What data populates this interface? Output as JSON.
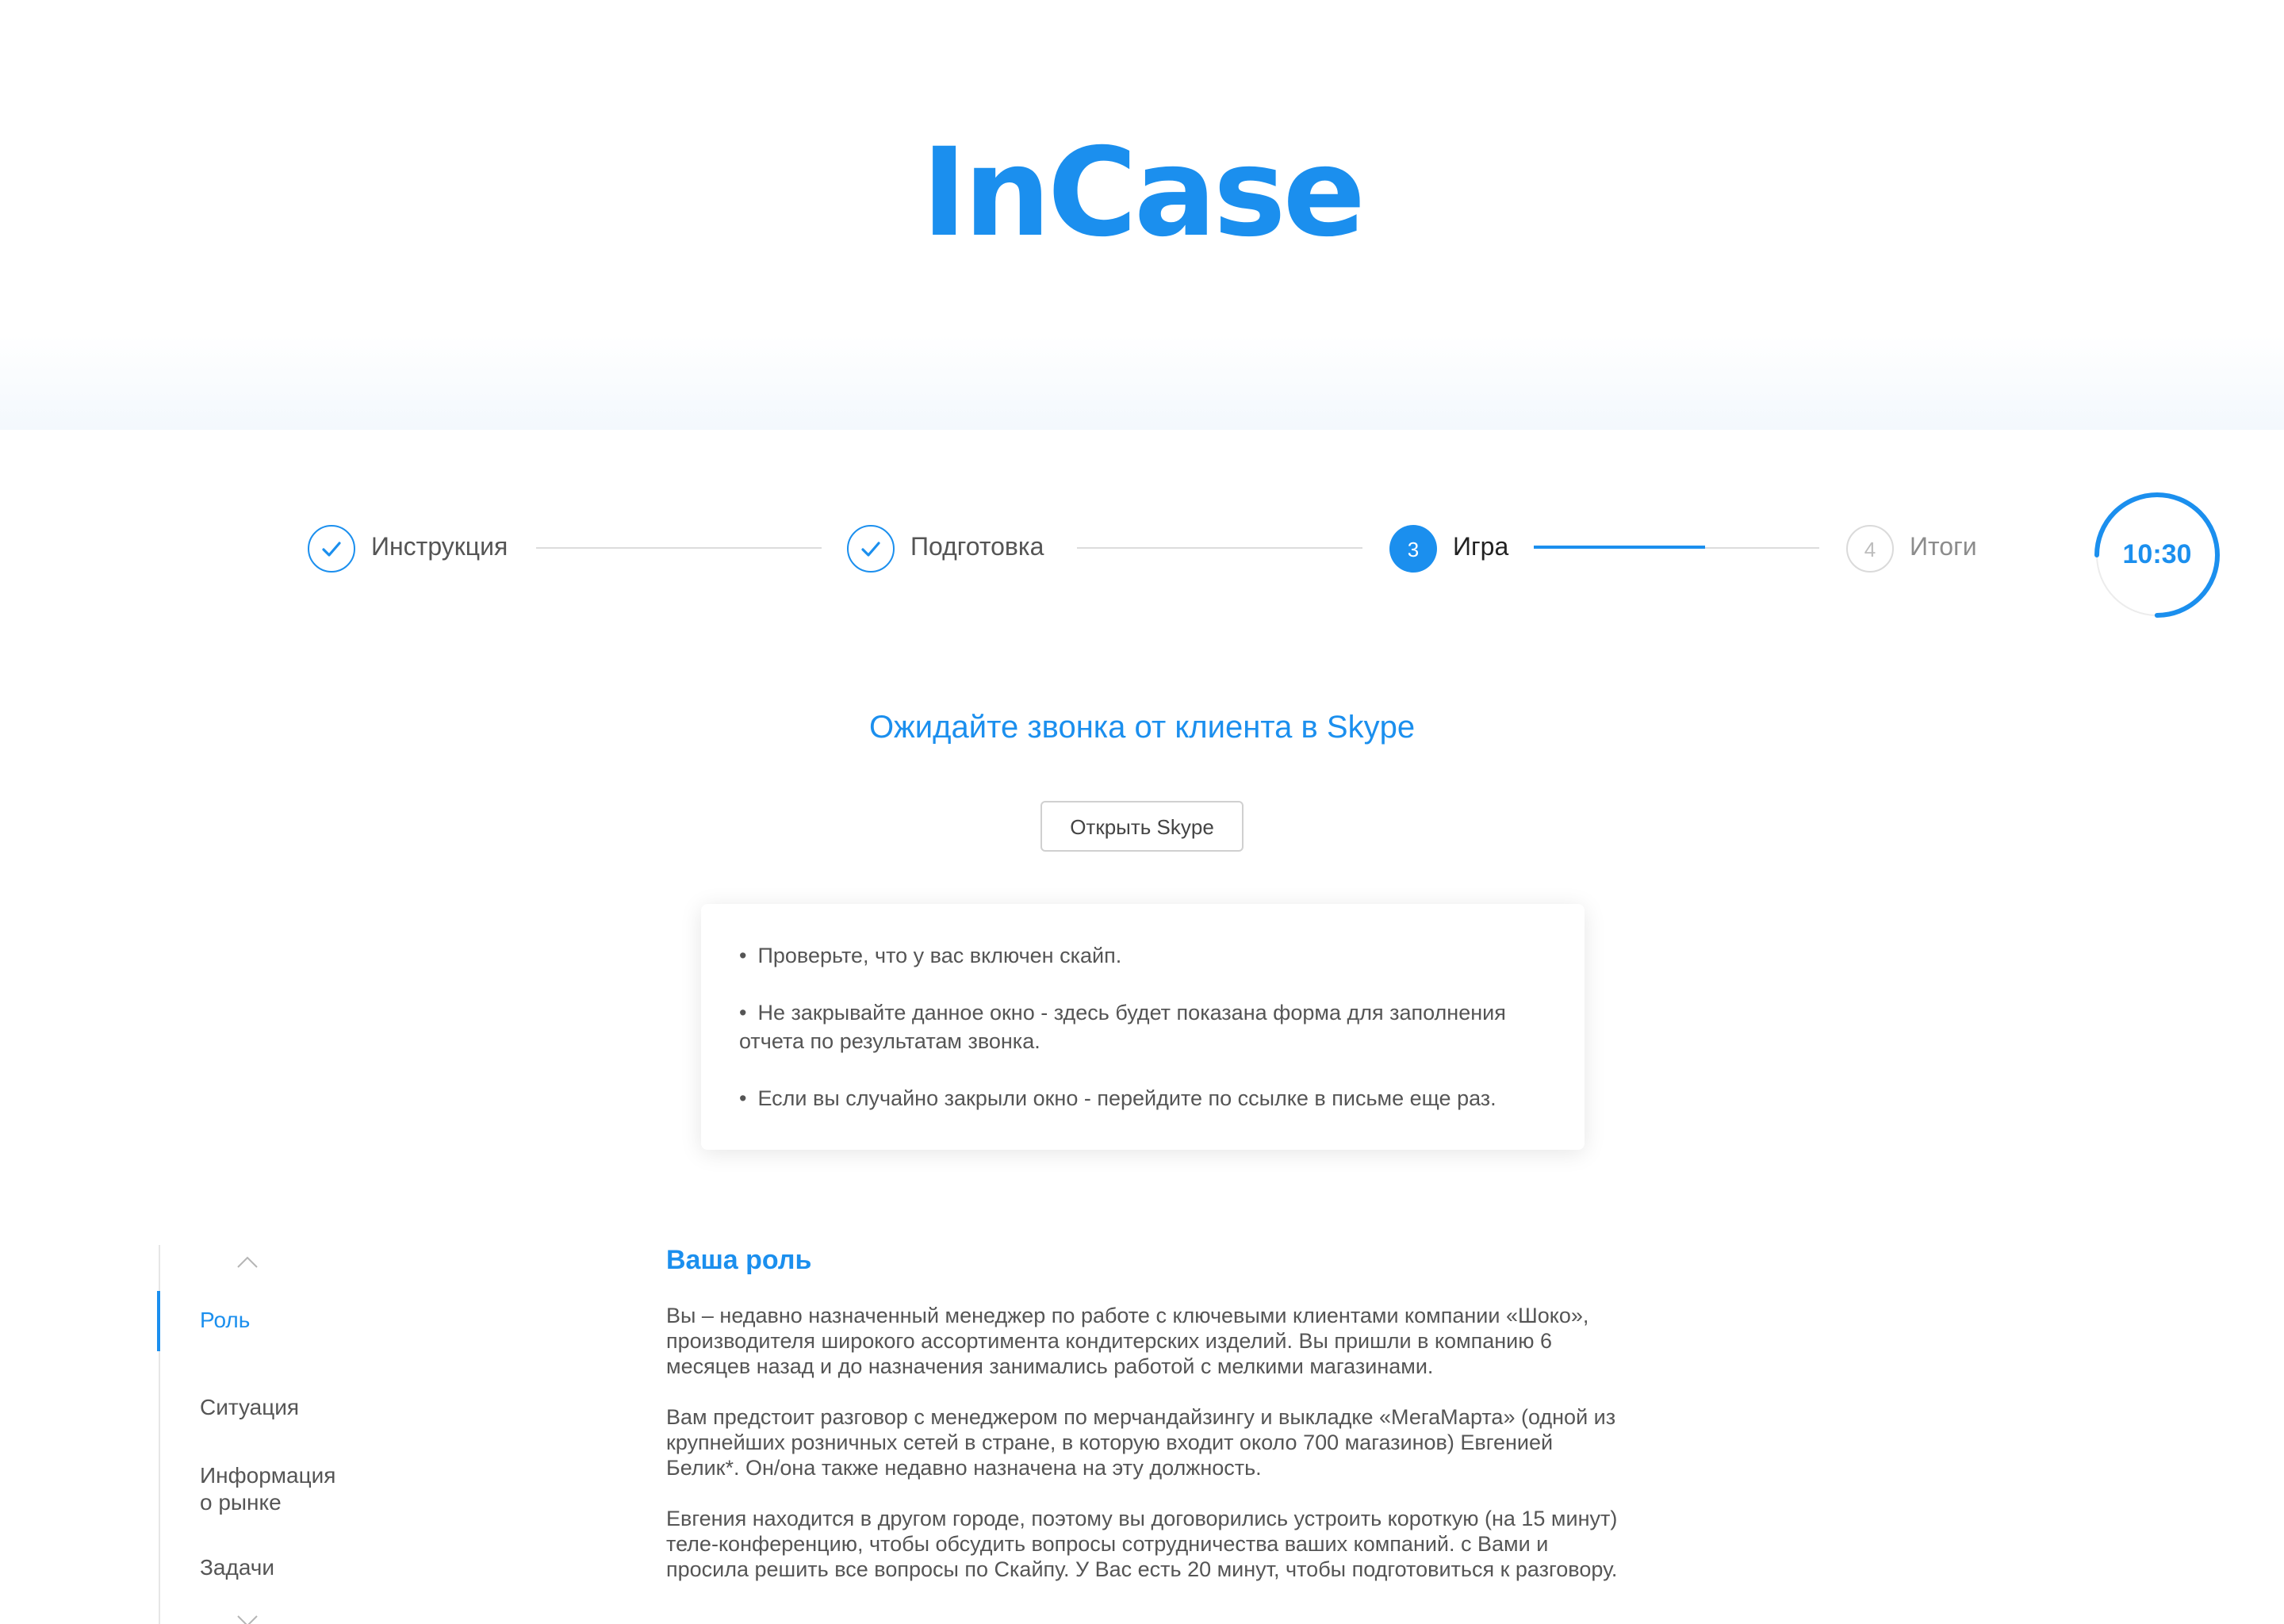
{
  "brand": {
    "logo_text": "InCase",
    "accent_color": "#1b8fee"
  },
  "stepper": {
    "steps": [
      {
        "number": "",
        "label": "Инструкция",
        "state": "done",
        "icon": "check-icon"
      },
      {
        "number": "",
        "label": "Подготовка",
        "state": "done",
        "icon": "check-icon"
      },
      {
        "number": "3",
        "label": "Игра",
        "state": "active"
      },
      {
        "number": "4",
        "label": "Итоги",
        "state": "todo"
      }
    ],
    "current_step_progress": 0.6
  },
  "timer": {
    "value": "10:30",
    "remaining_fraction": 0.75
  },
  "call": {
    "title": "Ожидайте звонка от клиента в Skype",
    "open_button_label": "Открыть Skype",
    "tips": [
      "Проверьте, что у вас включен скайп.",
      "Не закрывайте данное окно - здесь будет показана форма для заполнения отчета по результатам звонка.",
      "Если вы случайно закрыли окно - перейдите по ссылке в письме еще раз."
    ]
  },
  "side_nav": {
    "up_icon": "chevron-up-icon",
    "down_icon": "chevron-down-icon",
    "items": [
      {
        "label": "Роль",
        "active": true
      },
      {
        "label": "Ситуация",
        "active": false
      },
      {
        "label": "Информация\nо рынке",
        "active": false
      },
      {
        "label": "Задачи",
        "active": false
      }
    ]
  },
  "role": {
    "title": "Ваша роль",
    "paragraphs": [
      "Вы – недавно назначенный менеджер по работе с ключевыми клиентами компании «Шоко», производителя широкого ассортимента кондитерских изделий. Вы пришли в компанию 6 месяцев назад и до назначения занимались работой с мелкими магазинами.",
      "Вам предстоит разговор с менеджером по мерчандайзингу и выкладке «МегаМарта» (одной из крупнейших розничных сетей в стране, в которую входит около 700 магазинов) Евгенией Белик*. Он/она также недавно назначена на эту должность.",
      "Евгения находится в другом городе, поэтому вы договорились устроить короткую (на 15 минут) теле-конференцию, чтобы обсудить вопросы сотрудничества ваших компаний. с Вами и просила решить все вопросы по Скайпу. У Вас есть 20 минут, чтобы подготовиться к разговору."
    ]
  }
}
